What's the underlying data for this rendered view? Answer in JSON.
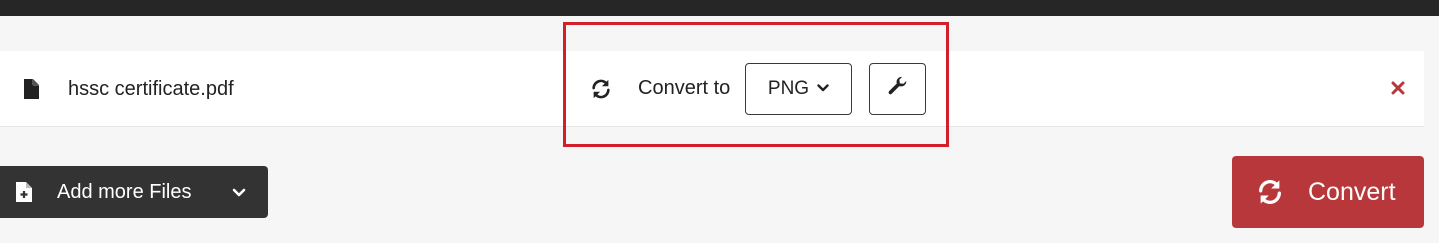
{
  "file": {
    "name": "hssc certificate.pdf",
    "icon": "file-icon"
  },
  "conversion": {
    "label": "Convert to",
    "format_value": "PNG",
    "refresh_icon": "refresh-icon",
    "settings_icon": "wrench-icon",
    "remove_icon": "close-icon"
  },
  "actions": {
    "add_files_label": "Add more Files",
    "convert_label": "Convert"
  },
  "colors": {
    "accent": "#b7373a",
    "highlight": "#d21f2a",
    "dark_button": "#333333",
    "topbar": "#262626"
  }
}
